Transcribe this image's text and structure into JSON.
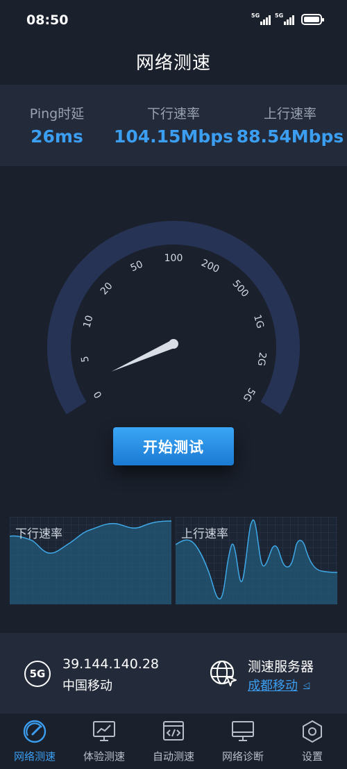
{
  "status_bar": {
    "time": "08:50",
    "sim1": "5G",
    "sim2": "5G"
  },
  "page_title": "网络测速",
  "metrics": [
    {
      "label": "Ping时延",
      "value": "26ms"
    },
    {
      "label": "下行速率",
      "value": "104.15Mbps"
    },
    {
      "label": "上行速率",
      "value": "88.54Mbps"
    }
  ],
  "gauge": {
    "ticks": [
      "0",
      "5",
      "10",
      "20",
      "50",
      "100",
      "200",
      "500",
      "1G",
      "2G",
      "5G"
    ],
    "needle_fraction": 0.0
  },
  "start_button": "开始测试",
  "graphs": {
    "download_label": "下行速率",
    "upload_label": "上行速率"
  },
  "network": {
    "type_badge": "5G",
    "ip": "39.144.140.28",
    "carrier": "中国移动"
  },
  "server": {
    "title": "测速服务器",
    "name": "成都移动"
  },
  "nav": [
    {
      "label": "网络测速",
      "icon": "speedometer-icon",
      "active": true
    },
    {
      "label": "体验测速",
      "icon": "monitor-chart-icon",
      "active": false
    },
    {
      "label": "自动测速",
      "icon": "code-window-icon",
      "active": false
    },
    {
      "label": "网络诊断",
      "icon": "monitor-icon",
      "active": false
    },
    {
      "label": "设置",
      "icon": "gear-icon",
      "active": false
    }
  ],
  "colors": {
    "accent": "#3b9ef0",
    "background": "#1a202c",
    "panel": "#232b3b",
    "gauge_arc": "#263354"
  }
}
